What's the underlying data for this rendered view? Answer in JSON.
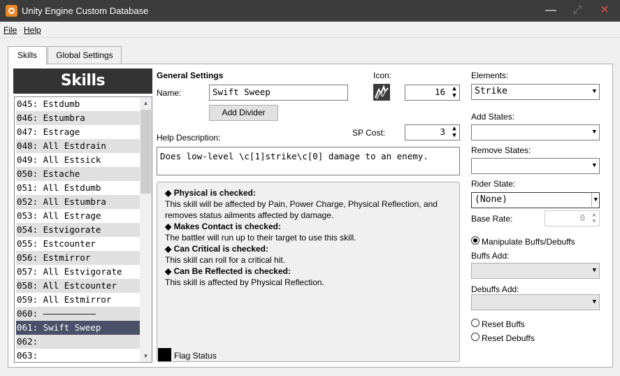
{
  "window": {
    "title": "Unity Engine Custom Database",
    "icons": [
      "app-icon",
      "minimize-icon",
      "maximize-icon",
      "close-icon"
    ]
  },
  "menu": {
    "file": "File",
    "help": "Help"
  },
  "tabs": {
    "skills": "Skills",
    "global": "Global Settings"
  },
  "skills_panel": {
    "header": "Skills",
    "items": [
      "045: Estdumb",
      "046: Estumbra",
      "047: Estrage",
      "048: All Estdrain",
      "049: All Estsick",
      "050: Estache",
      "051: All Estdumb",
      "052: All Estumbra",
      "053: All Estrage",
      "054: Estvigorate",
      "055: Estcounter",
      "056: Estmirror",
      "057: All Estvigorate",
      "058: All Estcounter",
      "059: All Estmirror",
      "060: ——————————",
      "061: Swift Sweep",
      "062:",
      "063:"
    ],
    "selected_index": 16
  },
  "general": {
    "heading": "General Settings",
    "name_label": "Name:",
    "name_value": "Swift Sweep",
    "add_divider": "Add Divider",
    "icon_label": "Icon:",
    "icon_value": "16",
    "sp_cost_label": "SP Cost:",
    "sp_cost_value": "3",
    "help_label": "Help Description:",
    "help_value": "Does low-level \\c[1]strike\\c[0] damage to an enemy."
  },
  "info": {
    "lines": [
      {
        "text": "◆ Physical is checked:",
        "bold": true
      },
      {
        "text": "This skill will be affected by Pain, Power Charge, Physical Reflection, and",
        "bold": false
      },
      {
        "text": "removes status ailments affected by damage.",
        "bold": false
      },
      {
        "text": "◆ Makes Contact is checked:",
        "bold": true
      },
      {
        "text": "The battler will run up to their target to use this skill.",
        "bold": false
      },
      {
        "text": "◆ Can Critical is checked:",
        "bold": true
      },
      {
        "text": "This skill can roll for a critical hit.",
        "bold": false
      },
      {
        "text": "◆ Can Be Reflected is checked:",
        "bold": true
      },
      {
        "text": "This skill is affected by Physical Reflection.",
        "bold": false
      }
    ],
    "flag_status": "Flag Status"
  },
  "right": {
    "elements_label": "Elements:",
    "elements_value": "Strike",
    "add_states_label": "Add States:",
    "remove_states_label": "Remove States:",
    "rider_state_label": "Rider State:",
    "rider_state_value": "(None)",
    "base_rate_label": "Base Rate:",
    "base_rate_value": "0",
    "manipulate_label": "Manipulate Buffs/Debuffs",
    "buffs_add_label": "Buffs Add:",
    "debuffs_add_label": "Debuffs Add:",
    "reset_buffs_label": "Reset Buffs",
    "reset_debuffs_label": "Reset Debuffs"
  }
}
